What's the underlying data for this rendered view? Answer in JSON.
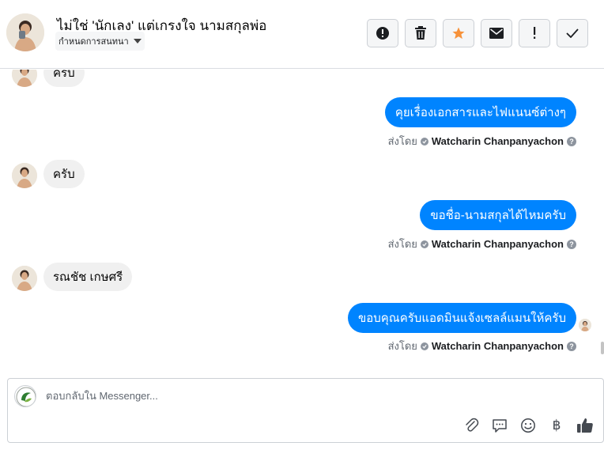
{
  "header": {
    "title": "ไม่ใช่ 'นักเลง' แต่เกรงใจ นามสกุลพ่อ",
    "assign_label": "กำหนดการสนทนา"
  },
  "toolbar": {
    "buttons": [
      "spam-alert",
      "delete",
      "star",
      "mark-unread",
      "important",
      "done"
    ]
  },
  "messages": [
    {
      "direction": "in",
      "text": "ครับ"
    },
    {
      "direction": "out",
      "text": "คุยเรื่องเอกสารและไฟแนนซ์ต่างๆ",
      "sent_by_prefix": "ส่งโดย",
      "sender": "Watcharin Chanpanyachon"
    },
    {
      "direction": "in",
      "text": "ครับ"
    },
    {
      "direction": "out",
      "text": "ขอชื่อ-นามสกุลได้ไหมครับ",
      "sent_by_prefix": "ส่งโดย",
      "sender": "Watcharin Chanpanyachon"
    },
    {
      "direction": "in",
      "text": "รณชัช เกษศรี"
    },
    {
      "direction": "out",
      "text": "ขอบคุณครับแอดมินแจ้งเซลล์แมนให้ครับ",
      "sent_by_prefix": "ส่งโดย",
      "sender": "Watcharin Chanpanyachon"
    }
  ],
  "composer": {
    "placeholder": "ตอบกลับใน Messenger...",
    "currency_symbol": "฿"
  },
  "colors": {
    "accent": "#0084ff",
    "star": "#f7923a",
    "incoming_bubble": "#f0f0f0"
  }
}
